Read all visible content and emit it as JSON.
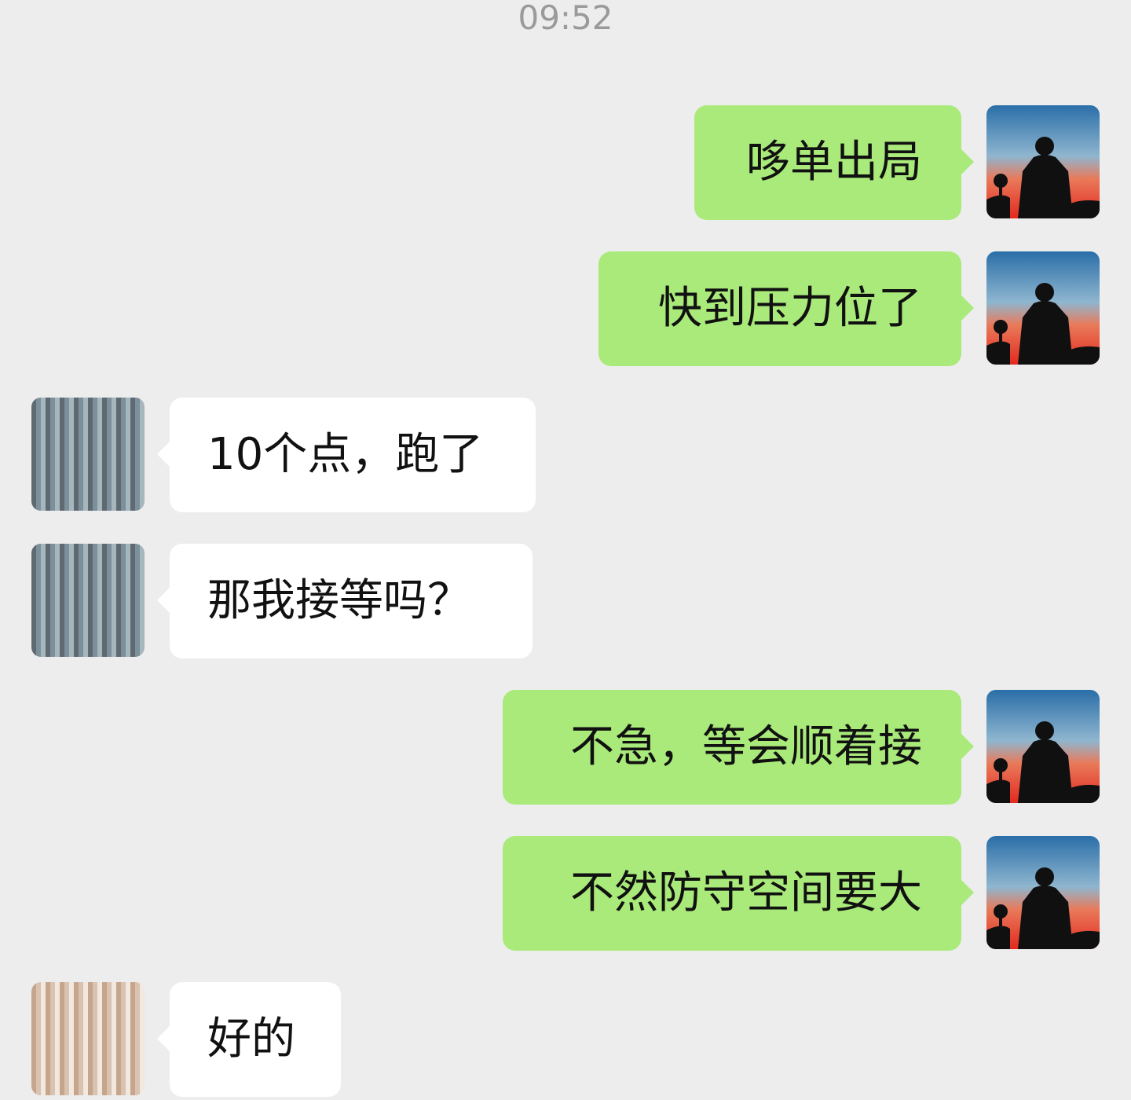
{
  "timestamp": "09:52",
  "messages": [
    {
      "direction": "out",
      "text": "哆单出局"
    },
    {
      "direction": "out",
      "text": "快到压力位了"
    },
    {
      "direction": "in",
      "text": "10个点，跑了"
    },
    {
      "direction": "in",
      "text": "那我接等吗？"
    },
    {
      "direction": "out",
      "text": "不急，等会顺着接"
    },
    {
      "direction": "out",
      "text": "不然防守空间要大"
    },
    {
      "direction": "in",
      "text": "好的"
    }
  ],
  "colors": {
    "background": "#EDEDED",
    "outgoing_bubble": "#A9EA7A",
    "incoming_bubble": "#FFFFFF",
    "timestamp": "#9A9A9A"
  },
  "icons": {
    "self_avatar": "sunset-silhouette-avatar",
    "other_avatar": "redacted-avatar"
  }
}
